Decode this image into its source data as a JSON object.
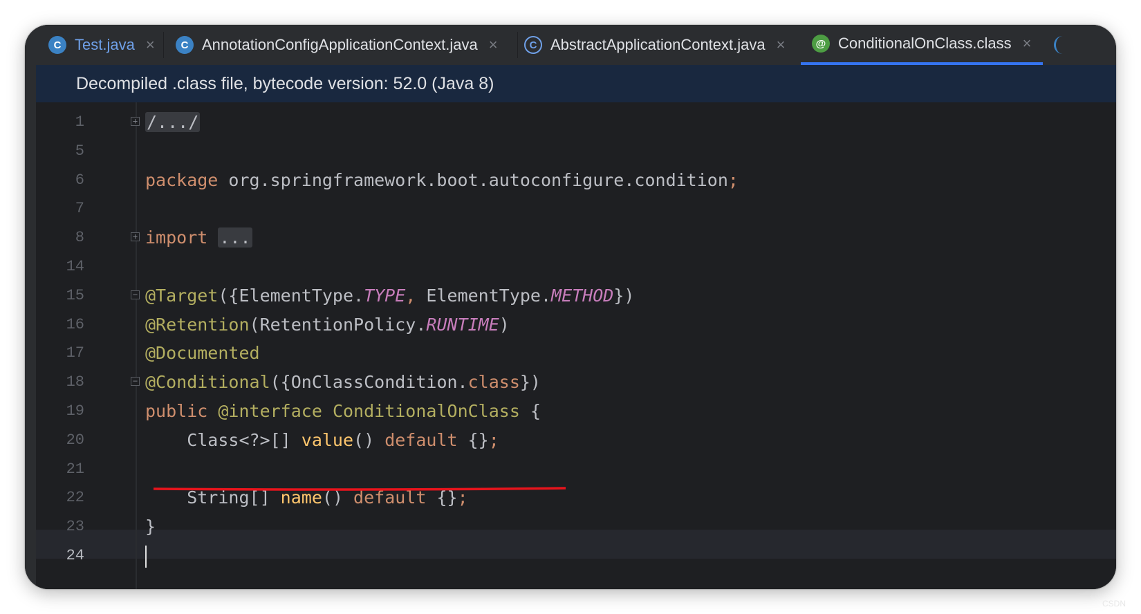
{
  "tabs": [
    {
      "label": "Test.java",
      "icon": "c-run-icon",
      "icon_glyph": "C",
      "active": false,
      "color": "#6fa0e8"
    },
    {
      "label": "AnnotationConfigApplicationContext.java",
      "icon": "class-icon",
      "icon_glyph": "C",
      "active": false,
      "color": "#dfe1e5"
    },
    {
      "label": "AbstractApplicationContext.java",
      "icon": "abstract-class-icon",
      "icon_glyph": "C",
      "active": false,
      "color": "#dfe1e5"
    },
    {
      "label": "ConditionalOnClass.class",
      "icon": "annotation-icon",
      "icon_glyph": "@",
      "active": true,
      "color": "#dfe1e5"
    }
  ],
  "close_glyph": "×",
  "banner": {
    "text": "Decompiled .class file, bytecode version: 52.0 (Java 8)"
  },
  "editor": {
    "current_line": "24",
    "lines": [
      {
        "n": "1",
        "fold": "+",
        "tokens": [
          [
            "fdbox",
            "/.../"
          ]
        ]
      },
      {
        "n": "5",
        "tokens": []
      },
      {
        "n": "6",
        "tokens": [
          [
            "kw",
            "package"
          ],
          [
            "",
            " org.springframework.boot.autoconfigure.condition"
          ],
          [
            "kw",
            ";"
          ]
        ]
      },
      {
        "n": "7",
        "tokens": []
      },
      {
        "n": "8",
        "fold": "+",
        "tokens": [
          [
            "kw",
            "import"
          ],
          [
            "",
            " "
          ],
          [
            "fdbox",
            "..."
          ]
        ]
      },
      {
        "n": "14",
        "tokens": []
      },
      {
        "n": "15",
        "fold": "-",
        "tokens": [
          [
            "ann",
            "@Target"
          ],
          [
            "",
            "({ElementType."
          ],
          [
            "fld",
            "TYPE"
          ],
          [
            "kw",
            ","
          ],
          [
            "",
            " ElementType."
          ],
          [
            "fld",
            "METHOD"
          ],
          [
            "",
            "})"
          ]
        ]
      },
      {
        "n": "16",
        "tokens": [
          [
            "ann",
            "@Retention"
          ],
          [
            "",
            "(RetentionPolicy."
          ],
          [
            "fld",
            "RUNTIME"
          ],
          [
            "",
            ")"
          ]
        ]
      },
      {
        "n": "17",
        "tokens": [
          [
            "ann",
            "@Documented"
          ]
        ]
      },
      {
        "n": "18",
        "fold": "-",
        "tokens": [
          [
            "ann",
            "@Conditional"
          ],
          [
            "",
            "({OnClassCondition."
          ],
          [
            "kw",
            "class"
          ],
          [
            "",
            "})"
          ]
        ]
      },
      {
        "n": "19",
        "tokens": [
          [
            "kw",
            "public"
          ],
          [
            "",
            " "
          ],
          [
            "ann",
            "@interface"
          ],
          [
            "",
            " "
          ],
          [
            "ann",
            "ConditionalOnClass"
          ],
          [
            "",
            " {"
          ]
        ]
      },
      {
        "n": "20",
        "tokens": [
          [
            "",
            "    Class<?>[] "
          ],
          [
            "fn",
            "value"
          ],
          [
            "",
            "() "
          ],
          [
            "kw",
            "default"
          ],
          [
            "",
            " {}"
          ],
          [
            "kw",
            ";"
          ]
        ]
      },
      {
        "n": "21",
        "tokens": []
      },
      {
        "n": "22",
        "tokens": [
          [
            "",
            "    String[] "
          ],
          [
            "fn",
            "name"
          ],
          [
            "",
            "() "
          ],
          [
            "kw",
            "default"
          ],
          [
            "",
            " {}"
          ],
          [
            "kw",
            ";"
          ]
        ]
      },
      {
        "n": "23",
        "tokens": [
          [
            "",
            "}"
          ]
        ]
      },
      {
        "n": "24",
        "tokens": [
          [
            "cursor",
            ""
          ]
        ]
      }
    ]
  },
  "highlight": {
    "color": "#e8141c"
  },
  "watermark": "CSDN"
}
